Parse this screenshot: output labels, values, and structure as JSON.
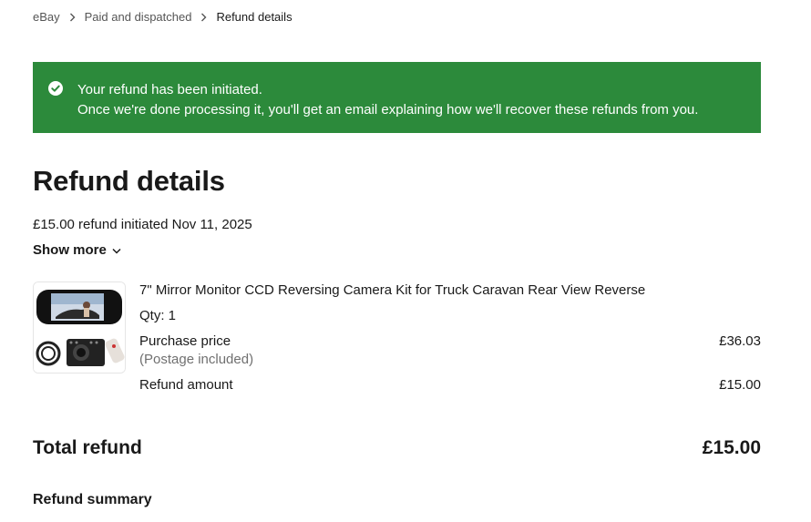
{
  "breadcrumb": {
    "items": [
      "eBay",
      "Paid and dispatched"
    ],
    "current": "Refund details"
  },
  "banner": {
    "line1": "Your refund has been initiated.",
    "line2": "Once we're done processing it, you'll get an email explaining how we'll recover these refunds from you.",
    "color": "#2c8a3b"
  },
  "page": {
    "title": "Refund details",
    "initiated_text": "£15.00 refund initiated Nov 11, 2025",
    "show_more": "Show more"
  },
  "item": {
    "title": "7\" Mirror Monitor CCD Reversing Camera Kit for Truck Caravan Rear View Reverse",
    "qty": "Qty: 1",
    "purchase_price_label": "Purchase price",
    "purchase_price": "£36.03",
    "postage_note": "(Postage included)",
    "refund_amount_label": "Refund amount",
    "refund_amount": "£15.00"
  },
  "total": {
    "label": "Total refund",
    "value": "£15.00"
  },
  "summary": {
    "title": "Refund summary"
  }
}
